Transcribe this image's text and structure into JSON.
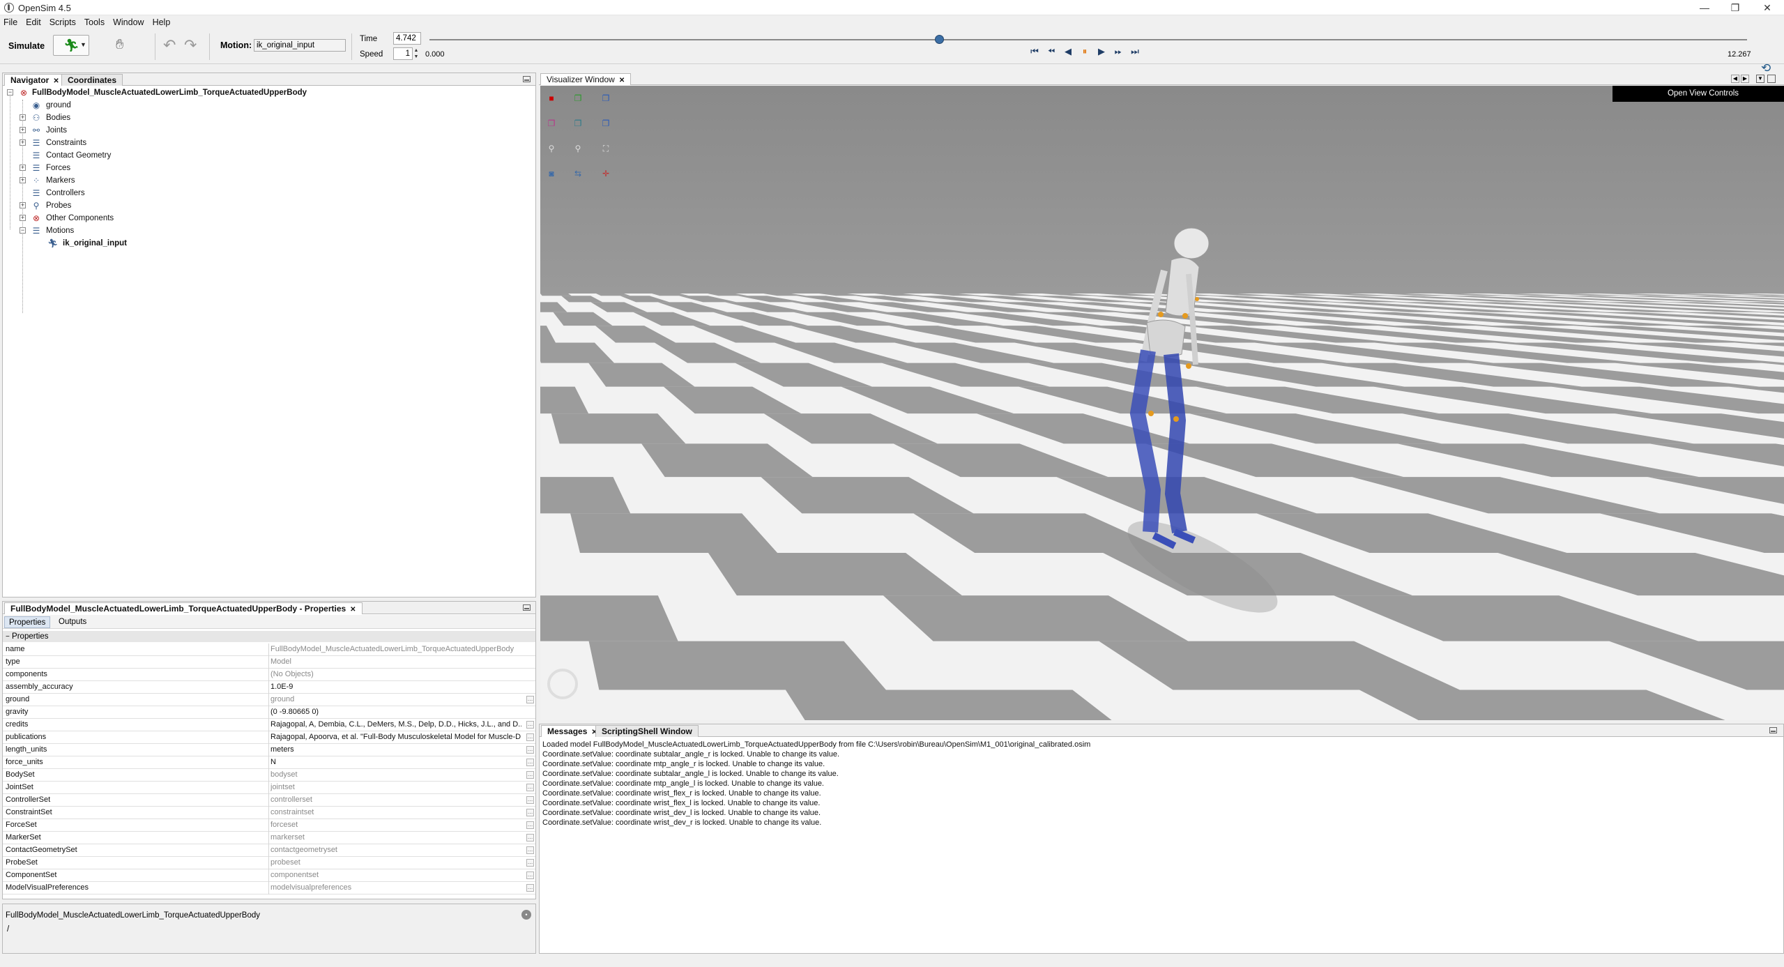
{
  "window": {
    "title": "OpenSim 4.5"
  },
  "menubar": {
    "items": [
      "File",
      "Edit",
      "Scripts",
      "Tools",
      "Window",
      "Help"
    ]
  },
  "toolbar": {
    "simulate_label": "Simulate",
    "motion_label": "Motion:",
    "motion_value": "ik_original_input",
    "time_label": "Time",
    "time_value": "4.742",
    "speed_label": "Speed",
    "speed_value": "1",
    "range_start": "0.000",
    "range_end": "12.267",
    "playhead_fraction": 0.387
  },
  "navigator": {
    "tabs": [
      "Navigator",
      "Coordinates"
    ],
    "model_name": "FullBodyModel_MuscleActuatedLowerLimb_TorqueActuatedUpperBody",
    "items": [
      "ground",
      "Bodies",
      "Joints",
      "Constraints",
      "Contact Geometry",
      "Forces",
      "Markers",
      "Controllers",
      "Probes",
      "Other Components",
      "Motions"
    ],
    "motion_child": "ik_original_input"
  },
  "properties": {
    "panel_title": "FullBodyModel_MuscleActuatedLowerLimb_TorqueActuatedUpperBody - Properties",
    "tabs": [
      "Properties",
      "Outputs"
    ],
    "section": "Properties",
    "rows": [
      {
        "name": "name",
        "value": "FullBodyModel_MuscleActuatedLowerLimb_TorqueActuatedUpperBody",
        "gray": true
      },
      {
        "name": "type",
        "value": "Model",
        "gray": true
      },
      {
        "name": "components",
        "value": "(No Objects)",
        "gray": true
      },
      {
        "name": "assembly_accuracy",
        "value": "1.0E-9",
        "gray": false
      },
      {
        "name": "ground",
        "value": "ground",
        "gray": true
      },
      {
        "name": "gravity",
        "value": "(0 -9.80665 0)",
        "gray": false
      },
      {
        "name": "credits",
        "value": "Rajagopal, A, Dembia, C.L., DeMers, M.S., Delp, D.D., Hicks, J.L., and D...",
        "gray": false
      },
      {
        "name": "publications",
        "value": "Rajagopal, Apoorva, et al. \"Full-Body Musculoskeletal Model for Muscle-D...",
        "gray": false
      },
      {
        "name": "length_units",
        "value": "meters",
        "gray": false
      },
      {
        "name": "force_units",
        "value": "N",
        "gray": false
      },
      {
        "name": "BodySet",
        "value": "bodyset",
        "gray": true
      },
      {
        "name": "JointSet",
        "value": "jointset",
        "gray": true
      },
      {
        "name": "ControllerSet",
        "value": "controllerset",
        "gray": true
      },
      {
        "name": "ConstraintSet",
        "value": "constraintset",
        "gray": true
      },
      {
        "name": "ForceSet",
        "value": "forceset",
        "gray": true
      },
      {
        "name": "MarkerSet",
        "value": "markerset",
        "gray": true
      },
      {
        "name": "ContactGeometrySet",
        "value": "contactgeometryset",
        "gray": true
      },
      {
        "name": "ProbeSet",
        "value": "probeset",
        "gray": true
      },
      {
        "name": "ComponentSet",
        "value": "componentset",
        "gray": true
      },
      {
        "name": "ModelVisualPreferences",
        "value": "modelvisualpreferences",
        "gray": true
      }
    ],
    "description_title": "FullBodyModel_MuscleActuatedLowerLimb_TorqueActuatedUpperBody",
    "description_text": "/"
  },
  "visualizer": {
    "tab": "Visualizer Window",
    "open_view_controls": "Open View Controls"
  },
  "messages": {
    "tabs": [
      "Messages",
      "ScriptingShell Window"
    ],
    "lines": [
      "Loaded model FullBodyModel_MuscleActuatedLowerLimb_TorqueActuatedUpperBody from file C:\\Users\\robin\\Bureau\\OpenSim\\M1_001\\original_calibrated.osim",
      "Coordinate.setValue:  coordinate subtalar_angle_r is locked. Unable to change its value.",
      "Coordinate.setValue:  coordinate mtp_angle_r is locked. Unable to change its value.",
      "Coordinate.setValue:  coordinate subtalar_angle_l is locked. Unable to change its value.",
      "Coordinate.setValue:  coordinate mtp_angle_l is locked. Unable to change its value.",
      "Coordinate.setValue:  coordinate wrist_flex_r is locked. Unable to change its value.",
      "Coordinate.setValue:  coordinate wrist_flex_l is locked. Unable to change its value.",
      "Coordinate.setValue:  coordinate wrist_dev_l is locked. Unable to change its value.",
      "Coordinate.setValue:  coordinate wrist_dev_r is locked. Unable to change its value."
    ]
  }
}
